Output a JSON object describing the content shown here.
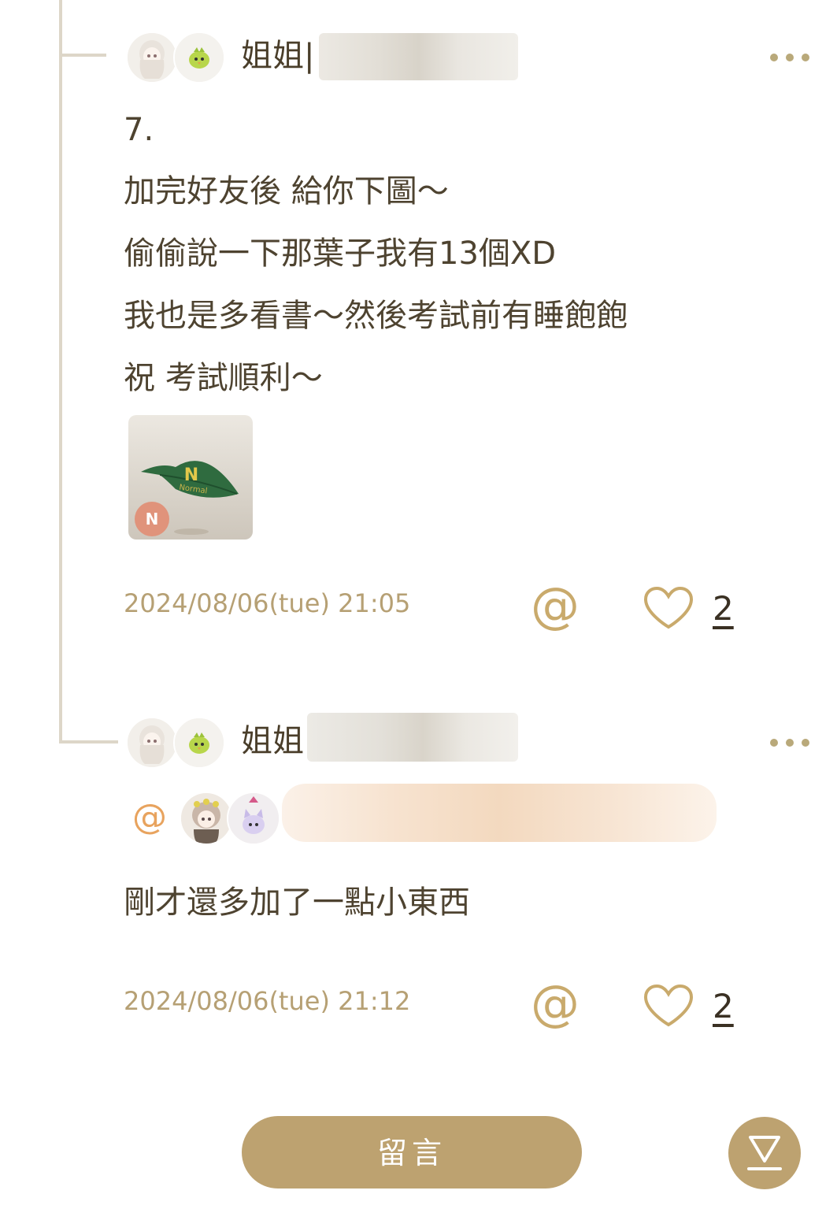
{
  "comments": [
    {
      "author_prefix": "姐姐|",
      "lines": [
        "7.",
        "加完好友後 給你下圖～",
        "偷偷說一下那葉子我有13個XD",
        "我也是多看書～然後考試前有睡飽飽",
        "祝 考試順利～"
      ],
      "sticker": {
        "leaf_letter": "N",
        "leaf_word": "Normal",
        "badge": "N"
      },
      "timestamp": "2024/08/06(tue) 21:05",
      "likes": "2"
    },
    {
      "author_prefix": "姐姐|",
      "mention_symbol": "@",
      "lines": [
        "剛才還多加了一點小東西"
      ],
      "timestamp": "2024/08/06(tue) 21:12",
      "likes": "2"
    }
  ],
  "footer": {
    "comment_button_label": "留言",
    "scroll_icon": "scroll-to-bottom-icon"
  },
  "colors": {
    "accent": "#bda270",
    "timestamp": "#b6a074",
    "at_icon": "#c9aa6c"
  }
}
